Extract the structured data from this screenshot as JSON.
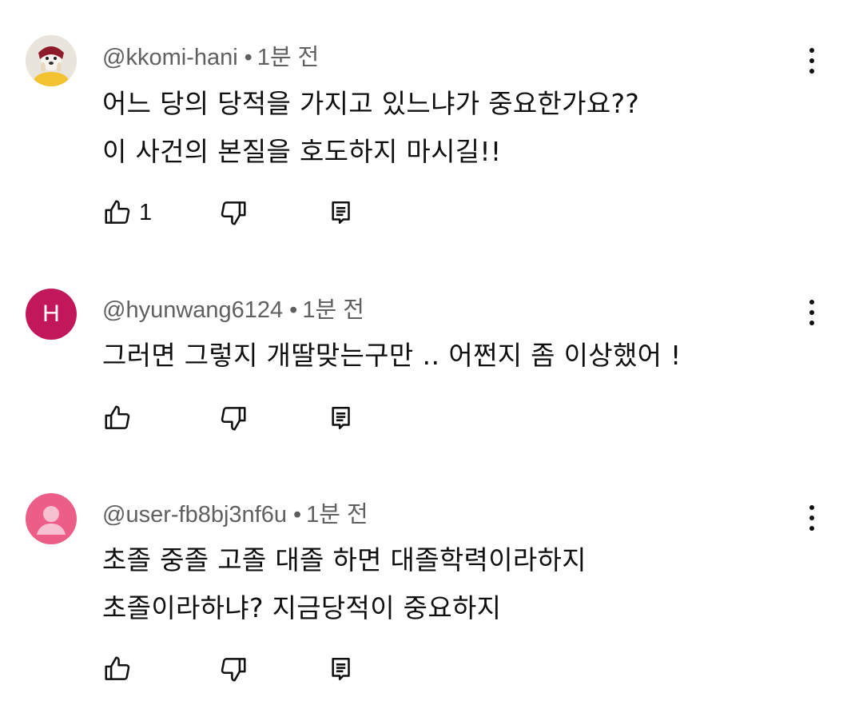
{
  "colors": {
    "text": "#0f0f0f",
    "meta": "#606060",
    "avatar_h": "#c2185b",
    "avatar_default": "#ec5e87",
    "avatar_default_light": "#f8c1d1"
  },
  "comments": [
    {
      "author": "@kkomi-hani",
      "time": "1분 전",
      "lines": [
        "어느 당의 당적을 가지고 있느냐가 중요한가요??",
        "이 사건의 본질을 호도하지 마시길!!"
      ],
      "avatar": "dog-photo",
      "likes": "1"
    },
    {
      "author": "@hyunwang6124",
      "time": "1분 전",
      "lines": [
        "그러면 그렇지 개딸맞는구만  ‥  어쩐지 좀 이상했어 !"
      ],
      "avatar_letter": "H",
      "likes": ""
    },
    {
      "author": "@user-fb8bj3nf6u",
      "time": "1분 전",
      "lines": [
        "초졸 중졸 고졸 대졸 하면 대졸학력이라하지",
        "초졸이라하냐? 지금당적이 중요하지"
      ],
      "avatar": "default-user-silhouette",
      "likes": ""
    }
  ],
  "separator": "•",
  "icons": {
    "like": "thumb-up-icon",
    "dislike": "thumb-down-icon",
    "reply": "reply-icon",
    "more": "more-vert-icon"
  }
}
